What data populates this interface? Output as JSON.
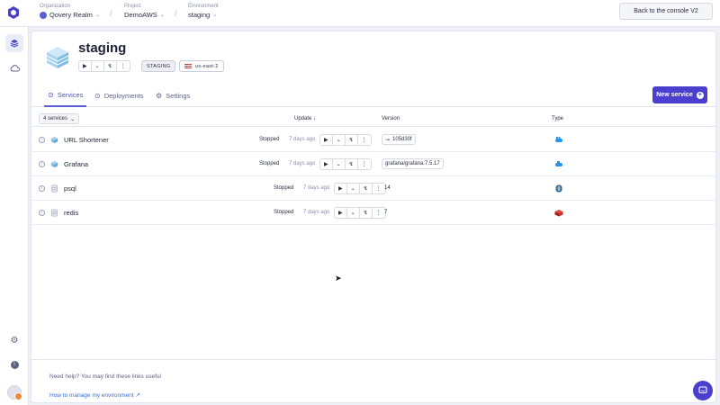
{
  "topbar": {
    "organization_label": "Organization",
    "organization_value": "Qovery Realm",
    "project_label": "Project",
    "project_value": "DemoAWS",
    "environment_label": "Environment",
    "environment_value": "staging",
    "back_button": "Back to the console V2"
  },
  "environment": {
    "title": "staging",
    "mode_chip": "STAGING",
    "region": "us-east-2"
  },
  "tabs": {
    "services": "Services",
    "deployments": "Deployments",
    "settings": "Settings"
  },
  "new_service_button": "New service",
  "table": {
    "count_label": "4 services",
    "col_update": "Update ↓",
    "col_version": "Version",
    "col_type": "Type",
    "rows": [
      {
        "name": "URL Shortener",
        "status": "Stopped",
        "updated": "7 days ago",
        "version": "105d30f",
        "type": "container"
      },
      {
        "name": "Grafana",
        "status": "Stopped",
        "updated": "7 days ago",
        "version": "grafana/grafana:7.5.17",
        "type": "container"
      },
      {
        "name": "psql",
        "status": "Stopped",
        "updated": "7 days ago",
        "version": "14",
        "type": "postgresql"
      },
      {
        "name": "redis",
        "status": "Stopped",
        "updated": "7 days ago",
        "version": "7",
        "type": "redis"
      }
    ]
  },
  "help": {
    "text": "Need help? You may find these links useful",
    "link": "How to manage my environment"
  },
  "colors": {
    "accent": "#4b3fd0",
    "docker": "#2496ed",
    "postgres": "#336791",
    "redis": "#d82c20"
  }
}
